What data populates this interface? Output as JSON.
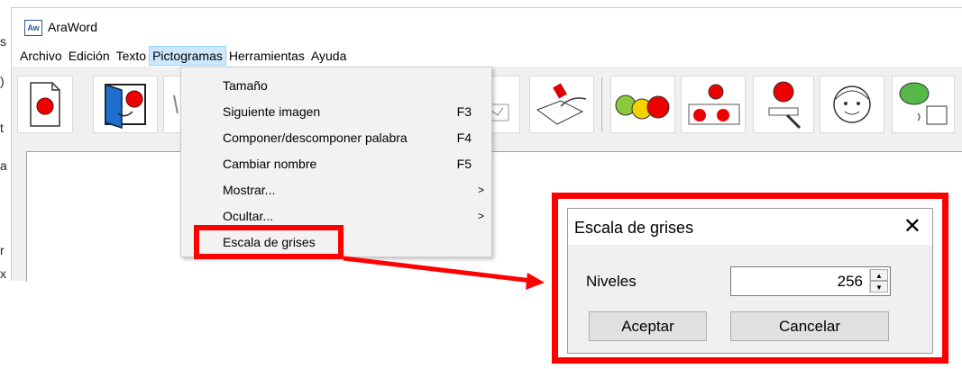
{
  "window": {
    "title": "AraWord",
    "icon_text": "Aw"
  },
  "menubar": {
    "items": [
      "Archivo",
      "Edición",
      "Texto",
      "Pictogramas",
      "Herramientas",
      "Ayuda"
    ],
    "active": "Pictogramas"
  },
  "menu": {
    "items": [
      {
        "label": "Tamaño",
        "shortcut": ""
      },
      {
        "label": "Siguiente imagen",
        "shortcut": "F3"
      },
      {
        "label": "Componer/descomponer palabra",
        "shortcut": "F4"
      },
      {
        "label": "Cambiar nombre",
        "shortcut": "F5"
      },
      {
        "label": "Mostrar...",
        "submenu": true
      },
      {
        "label": "Ocultar...",
        "submenu": true
      },
      {
        "label": "Escala de grises",
        "shortcut": ""
      }
    ]
  },
  "left_glyphs": [
    "s",
    ")",
    "t",
    "a",
    "r",
    "x"
  ],
  "dialog": {
    "title": "Escala de grises",
    "close_glyph": "✕",
    "niveles_label": "Niveles",
    "niveles_value": "256",
    "ok_label": "Aceptar",
    "cancel_label": "Cancelar"
  },
  "toolbar_icons": [
    "new-document-icon",
    "open-door-icon",
    "hidden-icon",
    "scissors-icon",
    "glue-icon",
    "apples-icon",
    "apple-to-red-icon",
    "apple-write-icon",
    "face-icon",
    "speaker-icon"
  ],
  "colors": {
    "highlight": "#ff0000",
    "menu_active": "#cce8ff"
  }
}
